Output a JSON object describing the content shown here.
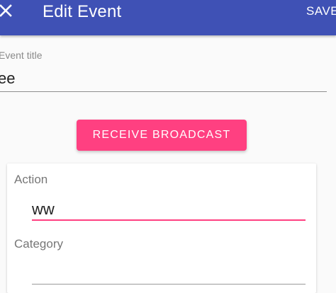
{
  "appbar": {
    "close_icon": "close-icon",
    "title": "Edit Event",
    "save_label": "SAVE"
  },
  "event_title": {
    "label": "Event title",
    "value": "ee"
  },
  "receive_button": {
    "label": "RECEIVE BROADCAST"
  },
  "broadcast_card": {
    "action_label": "Action",
    "action_value": "ww",
    "category_label": "Category",
    "category_value": ""
  },
  "colors": {
    "primary": "#3f51b5",
    "accent": "#ff4081",
    "background": "#fafafa"
  }
}
